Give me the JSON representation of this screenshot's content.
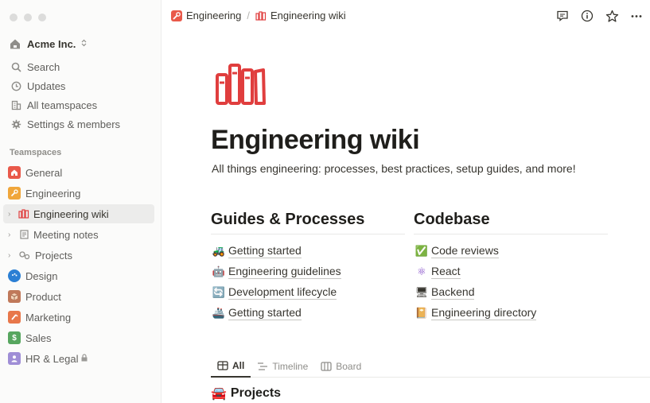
{
  "breadcrumb": {
    "parent": "Engineering",
    "separator": "/",
    "current": "Engineering wiki"
  },
  "workspace": {
    "name": "Acme Inc.",
    "switch_glyph": "⌃⌄"
  },
  "nav": [
    {
      "label": "Search",
      "icon": "search-icon"
    },
    {
      "label": "Updates",
      "icon": "clock-icon"
    },
    {
      "label": "All teamspaces",
      "icon": "building-icon"
    },
    {
      "label": "Settings & members",
      "icon": "gear-icon"
    }
  ],
  "teamspaces_label": "Teamspaces",
  "teamspaces": [
    {
      "label": "General",
      "color": "#e9594a"
    },
    {
      "label": "Engineering",
      "color": "#f0a63a"
    },
    {
      "label": "Engineering wiki",
      "active": true
    },
    {
      "label": "Meeting notes"
    },
    {
      "label": "Projects"
    },
    {
      "label": "Design",
      "color": "#2b7fd4"
    },
    {
      "label": "Product",
      "color": "#c0795a"
    },
    {
      "label": "Marketing",
      "color": "#e8774a"
    },
    {
      "label": "Sales",
      "color": "#57a65f"
    },
    {
      "label": "HR & Legal",
      "color": "#9f8ed6"
    }
  ],
  "page": {
    "title": "Engineering wiki",
    "subtitle": "All things engineering: processes, best practices, setup guides, and more!"
  },
  "guides": {
    "heading": "Guides & Processes",
    "items": [
      {
        "emoji": "🚜",
        "label": "Getting started"
      },
      {
        "emoji": "🤖",
        "label": "Engineering guidelines"
      },
      {
        "emoji": "🔄",
        "label": "Development lifecycle"
      },
      {
        "emoji": "🚢",
        "label": "Getting started"
      }
    ]
  },
  "codebase": {
    "heading": "Codebase",
    "items": [
      {
        "emoji": "✅",
        "label": "Code reviews"
      },
      {
        "emoji": "⚛",
        "label": "React"
      },
      {
        "emoji": "🖥",
        "label": "Backend"
      },
      {
        "emoji": "📔",
        "label": "Engineering directory"
      }
    ]
  },
  "tabs": [
    {
      "label": "All",
      "icon": "table-icon"
    },
    {
      "label": "Timeline",
      "icon": "timeline-icon"
    },
    {
      "label": "Board",
      "icon": "board-icon"
    }
  ],
  "projects": {
    "emoji": "🚘",
    "label": "Projects"
  },
  "colors": {
    "accent": "#e03e3e",
    "sidebar_bg": "#fbfbfa",
    "active_bg": "#ececeb"
  }
}
